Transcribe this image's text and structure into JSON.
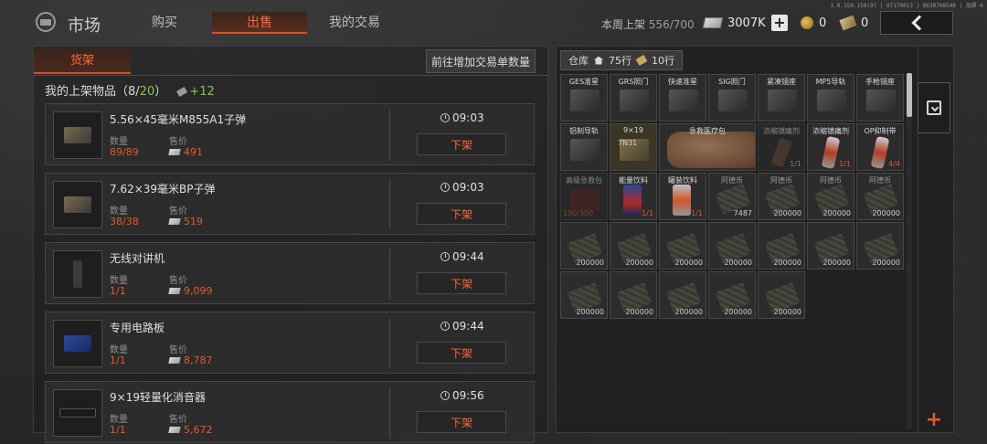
{
  "header": {
    "title": "市场",
    "tabs": [
      "购买",
      "出售",
      "我的交易"
    ],
    "version": "1.0.159.159(9) | 07170013 | 8639708548 | 品质-6",
    "weekly_label": "本周上架",
    "weekly_value": "556/700",
    "money": "3007K",
    "coins": "0",
    "bonds": "0"
  },
  "left": {
    "shelf_tab": "货架",
    "add_slots_button": "前往增加交易单数量",
    "my_items_label": "我的上架物品（",
    "my_items_count": "8",
    "my_items_sep": "/",
    "my_items_max": "20",
    "my_items_close": "）",
    "my_items_bonus": "+12",
    "qty_label": "数量",
    "price_label": "售价",
    "delist_label": "下架",
    "items": [
      {
        "name": "5.56×45毫米M855A1子弹",
        "qty": "89/89",
        "price": "491",
        "time": "09:03"
      },
      {
        "name": "7.62×39毫米BP子弹",
        "qty": "38/38",
        "price": "519",
        "time": "09:03"
      },
      {
        "name": "无线对讲机",
        "qty": "1/1",
        "price": "9,099",
        "time": "09:44"
      },
      {
        "name": "专用电路板",
        "qty": "1/1",
        "price": "8,787",
        "time": "09:44"
      },
      {
        "name": "9×19轻量化消音器",
        "qty": "1/1",
        "price": "5,672",
        "time": "09:56"
      }
    ]
  },
  "right": {
    "storage_label": "仓库",
    "rows_a": "75行",
    "rows_b": "10行",
    "cells": [
      {
        "name": "GES准星",
        "count": ""
      },
      {
        "name": "GRS照门",
        "count": ""
      },
      {
        "name": "快速准星",
        "count": ""
      },
      {
        "name": "SIG照门",
        "count": ""
      },
      {
        "name": "紧凑镜座",
        "count": ""
      },
      {
        "name": "MP5导轨",
        "count": ""
      },
      {
        "name": "手枪镜座",
        "count": ""
      },
      {
        "name": "铝制导轨",
        "count": ""
      },
      {
        "name": "9×19",
        "count": "7N31"
      },
      {
        "name": "急救医疗包",
        "count": ""
      },
      {
        "name": "浓缩镇痛剂",
        "count": "1/1"
      },
      {
        "name": "浓缩镇痛剂",
        "count": "1/1"
      },
      {
        "name": "OP抑制带",
        "count": "4/4"
      },
      {
        "name": "高级急救包",
        "count": "190/300"
      },
      {
        "name": "能量饮料",
        "count": "1/1"
      },
      {
        "name": "罐装饮料",
        "count": "1/1"
      },
      {
        "name": "阿德币",
        "count": "7487"
      },
      {
        "name": "阿德币",
        "count": "200000"
      },
      {
        "name": "阿德币",
        "count": "200000"
      },
      {
        "name": "阿德币",
        "count": "200000"
      },
      {
        "name": "",
        "count": "200000"
      },
      {
        "name": "",
        "count": "200000"
      },
      {
        "name": "",
        "count": "200000"
      },
      {
        "name": "",
        "count": "200000"
      },
      {
        "name": "",
        "count": "200000"
      },
      {
        "name": "",
        "count": "200000"
      },
      {
        "name": "",
        "count": "200000"
      },
      {
        "name": "",
        "count": "200000"
      },
      {
        "name": "",
        "count": "200000"
      },
      {
        "name": "",
        "count": "200000"
      },
      {
        "name": "",
        "count": "200000"
      },
      {
        "name": "",
        "count": "200000"
      }
    ]
  },
  "icons": {
    "logo": "market-logo-icon",
    "money": "cash-icon",
    "coin": "coin-icon",
    "bond": "bond-icon",
    "back": "chevron-left-icon",
    "sort": "sort-icon",
    "add": "plus-icon"
  },
  "colors": {
    "accent": "#ff6a3a",
    "price": "#e25a2a",
    "bonus": "#8bc34a"
  }
}
